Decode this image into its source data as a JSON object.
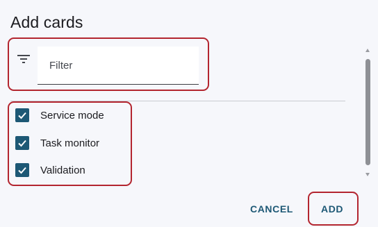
{
  "dialog": {
    "title": "Add cards"
  },
  "filter": {
    "placeholder": "Filter",
    "value": "",
    "icon": "filter-icon"
  },
  "cards": [
    {
      "label": "Service mode",
      "checked": true
    },
    {
      "label": "Task monitor",
      "checked": true
    },
    {
      "label": "Validation",
      "checked": true
    }
  ],
  "actions": {
    "cancel_label": "CANCEL",
    "add_label": "ADD"
  },
  "colors": {
    "accent": "#1d5875",
    "highlight": "#b3252f",
    "background": "#f6f7fb"
  }
}
